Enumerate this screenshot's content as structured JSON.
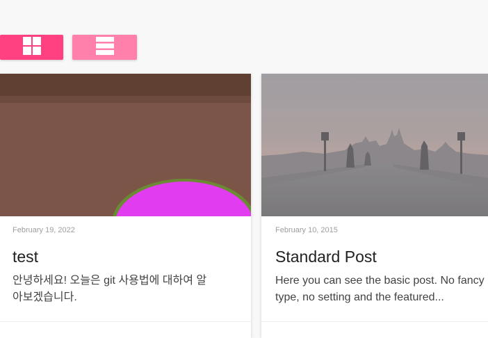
{
  "view_toggle": {
    "grid_icon": "grid-view-icon",
    "list_icon": "list-view-icon",
    "active_color": "#ff4081",
    "inactive_color": "#ff80ab"
  },
  "posts": [
    {
      "date": "February 19, 2022",
      "title": "test",
      "excerpt_lines": [
        "안녕하세요! 오늘은 git 사용법에 대하여 알",
        "아보겠습니다."
      ]
    },
    {
      "date": "February 10, 2015",
      "title": "Standard Post",
      "excerpt_lines": [
        "Here you can see the basic post. No fancy",
        "type, no setting and the featured..."
      ]
    }
  ]
}
